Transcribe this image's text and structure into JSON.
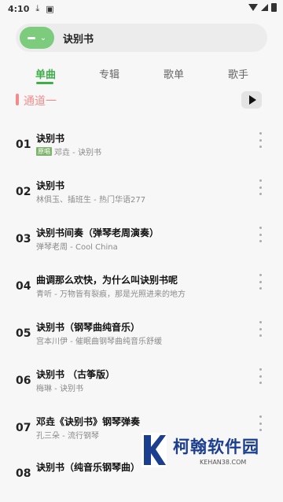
{
  "status": {
    "time": "4:10"
  },
  "search": {
    "query": "诀别书"
  },
  "tabs": [
    "单曲",
    "专辑",
    "歌单",
    "歌手"
  ],
  "channel": {
    "label": "通道一"
  },
  "songs": [
    {
      "num": "01",
      "title": "诀别书",
      "badge": "原唱",
      "sub": "邓垚 - 诀别书"
    },
    {
      "num": "02",
      "title": "诀别书",
      "badge": "",
      "sub": "林俱玉、插班生 - 热门华语277"
    },
    {
      "num": "03",
      "title": "诀别书间奏（弹琴老周演奏）",
      "badge": "",
      "sub": "弹琴老周 - Cool China"
    },
    {
      "num": "04",
      "title": "曲调那么欢快，为什么叫诀别书呢",
      "badge": "",
      "sub": "青听 - 万物皆有裂痕，那是光照进来的地方"
    },
    {
      "num": "05",
      "title": "诀别书（钢琴曲纯音乐）",
      "badge": "",
      "sub": "宫本川伊 - 催眠曲钢琴曲纯音乐舒缓"
    },
    {
      "num": "06",
      "title": "诀别书 （古筝版）",
      "badge": "",
      "sub": "梅琳 - 诀别书"
    },
    {
      "num": "07",
      "title": "邓垚《诀别书》钢琴弹奏",
      "badge": "",
      "sub": "孔三朵 - 流行钢琴"
    },
    {
      "num": "08",
      "title": "诀别书（纯音乐钢琴曲）",
      "badge": "",
      "sub": ""
    }
  ],
  "watermark": {
    "title": "柯翰软件园",
    "url": "KEHAN38.COM"
  }
}
